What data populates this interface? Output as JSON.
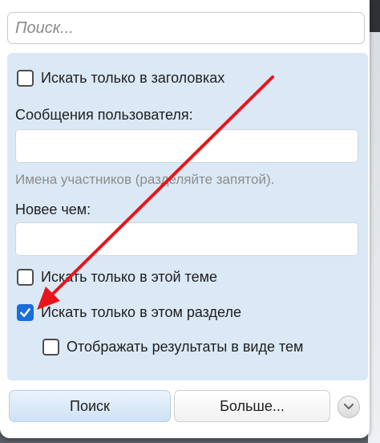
{
  "search": {
    "placeholder": "Поиск..."
  },
  "options": {
    "titles_only_label": "Искать только в заголовках",
    "user_messages_label": "Сообщения пользователя:",
    "user_messages_value": "",
    "user_messages_hint": "Имена участников (разделяйте запятой).",
    "newer_than_label": "Новее чем:",
    "newer_than_value": "",
    "this_thread_only_label": "Искать только в этой теме",
    "this_forum_only_label": "Искать только в этом разделе",
    "show_as_threads_label": "Отображать результаты в виде тем",
    "titles_only_checked": false,
    "this_thread_only_checked": false,
    "this_forum_only_checked": true,
    "show_as_threads_checked": false
  },
  "buttons": {
    "search_label": "Поиск",
    "more_label": "Больше..."
  },
  "annotation": {
    "arrow_color": "#e8141b"
  },
  "icons": {
    "dropdown": "chevron-down-icon",
    "checkmark": "check-icon"
  }
}
